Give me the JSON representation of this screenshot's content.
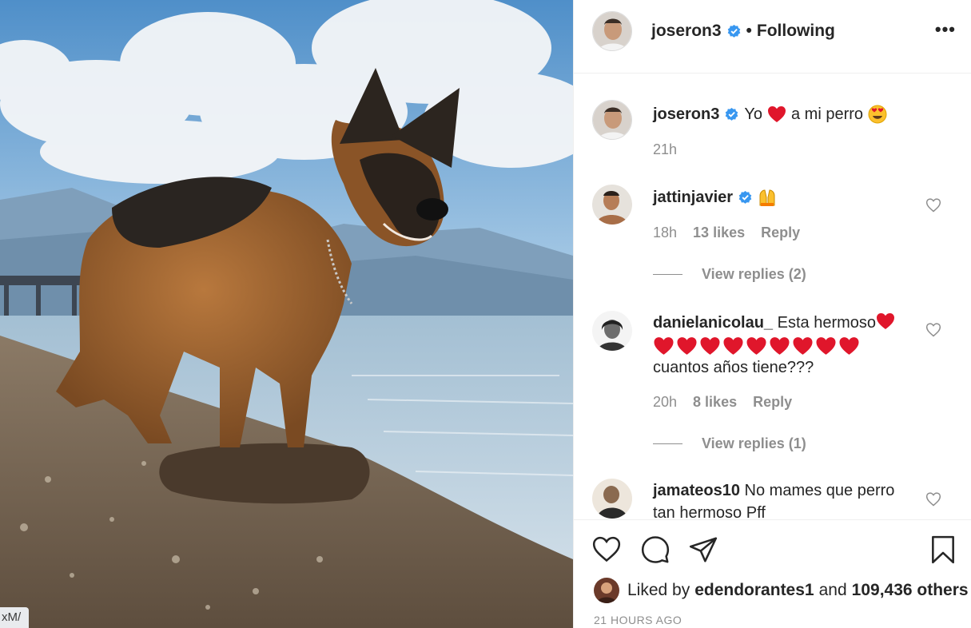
{
  "post": {
    "url_chip": "xM/",
    "author": "joseron3",
    "follow_separator": "•",
    "follow_status": "Following",
    "more_label": "•••"
  },
  "caption": {
    "username": "joseron3",
    "text_before": "Yo",
    "text_after": "a mi perro",
    "time": "21h"
  },
  "comments": [
    {
      "username": "jattinjavier",
      "text": "",
      "emoji": "raising-hands",
      "time": "18h",
      "likes": "13 likes",
      "reply": "Reply",
      "view_replies": "View replies (2)"
    },
    {
      "username": "danielanicolau_",
      "text": "Esta hermoso",
      "text_line3": "cuantos años tiene???",
      "time": "20h",
      "likes": "8 likes",
      "reply": "Reply",
      "view_replies": "View replies (1)"
    },
    {
      "username": "jamateos10",
      "text": "No mames que perro tan hermoso Pff"
    }
  ],
  "actions": {
    "liked_by_prefix": "Liked by",
    "liked_by_user": "edendorantes1",
    "liked_by_and": "and",
    "liked_by_count": "109,436 others",
    "timestamp": "21 HOURS AGO"
  },
  "colors": {
    "heart": "#ed4956",
    "verified": "#3897f0",
    "muted": "#8e8e8e",
    "text": "#262626"
  },
  "icons": [
    "verified-badge-icon",
    "heart-outline-icon",
    "comment-bubble-icon",
    "share-plane-icon",
    "bookmark-icon",
    "more-options-icon",
    "red-heart-emoji",
    "heart-eyes-emoji",
    "raising-hands-emoji"
  ]
}
